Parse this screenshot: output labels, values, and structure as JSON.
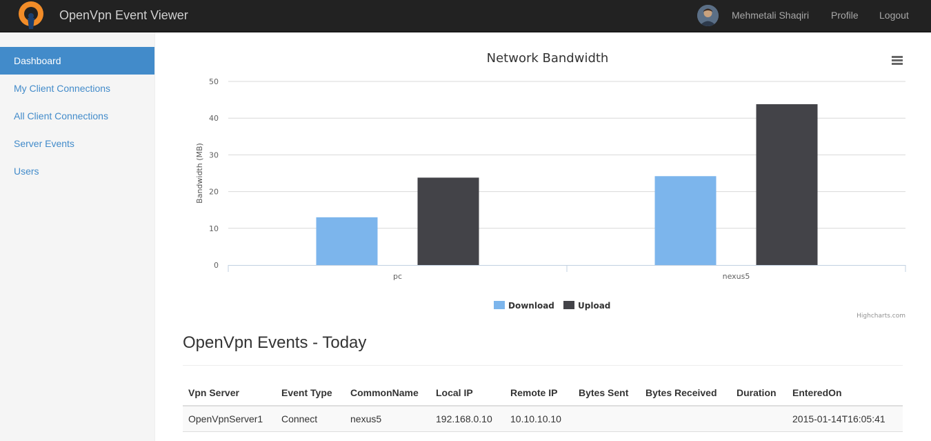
{
  "app": {
    "title": "OpenVpn Event Viewer"
  },
  "nav": {
    "user_name": "Mehmetali Shaqiri",
    "profile_label": "Profile",
    "logout_label": "Logout"
  },
  "sidebar": {
    "items": [
      {
        "label": "Dashboard",
        "active": true
      },
      {
        "label": "My Client Connections",
        "active": false
      },
      {
        "label": "All Client Connections",
        "active": false
      },
      {
        "label": "Server Events",
        "active": false
      },
      {
        "label": "Users",
        "active": false
      }
    ]
  },
  "colors": {
    "navbar": "#222222",
    "accent": "#428bca",
    "download": "#7cb5ec",
    "upload": "#434348",
    "logo_orange": "#f28c28"
  },
  "chart_data": {
    "type": "bar",
    "title": "Network Bandwidth",
    "ylabel": "Bandwidth (MB)",
    "xlabel": "",
    "ylim": [
      0,
      50
    ],
    "yticks": [
      0,
      10,
      20,
      30,
      40,
      50
    ],
    "categories": [
      "pc",
      "nexus5"
    ],
    "series": [
      {
        "name": "Download",
        "values": [
          13,
          24.2
        ]
      },
      {
        "name": "Upload",
        "values": [
          23.8,
          43.8
        ]
      }
    ],
    "grid": true,
    "legend": "bottom-center",
    "credit": "Highcharts.com",
    "menu_icon": "hamburger-menu-icon"
  },
  "events": {
    "title": "OpenVpn Events - Today",
    "columns": [
      "Vpn Server",
      "Event Type",
      "CommonName",
      "Local IP",
      "Remote IP",
      "Bytes Sent",
      "Bytes Received",
      "Duration",
      "EnteredOn"
    ],
    "rows": [
      [
        "OpenVpnServer1",
        "Connect",
        "nexus5",
        "192.168.0.10",
        "10.10.10.10",
        "",
        "",
        "",
        "2015-01-14T16:05:41"
      ]
    ]
  }
}
